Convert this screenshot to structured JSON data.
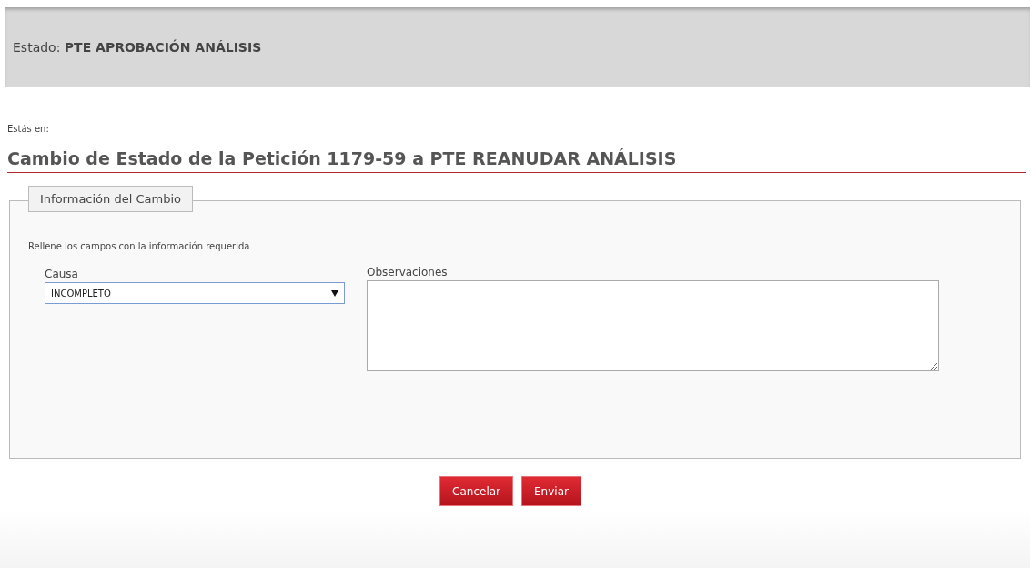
{
  "status_bar": {
    "text": "Estado: **PTE APROBACIÓN ANÁLISIS**"
  },
  "breadcrumb": {
    "label": "Estás en:"
  },
  "heading": "Cambio de Estado de la Petición 1179-59 a PTE REANUDAR ANÁLISIS",
  "form": {
    "legend": "Información del Cambio",
    "instructions": "Rellene los campos con la información requerida",
    "fields": [
      {
        "kind": "select",
        "label": "Causa",
        "value": "INCOMPLETO"
      },
      {
        "kind": "textarea",
        "label": "Observaciones"
      }
    ]
  },
  "buttons": [
    "Cancelar",
    "Enviar"
  ]
}
